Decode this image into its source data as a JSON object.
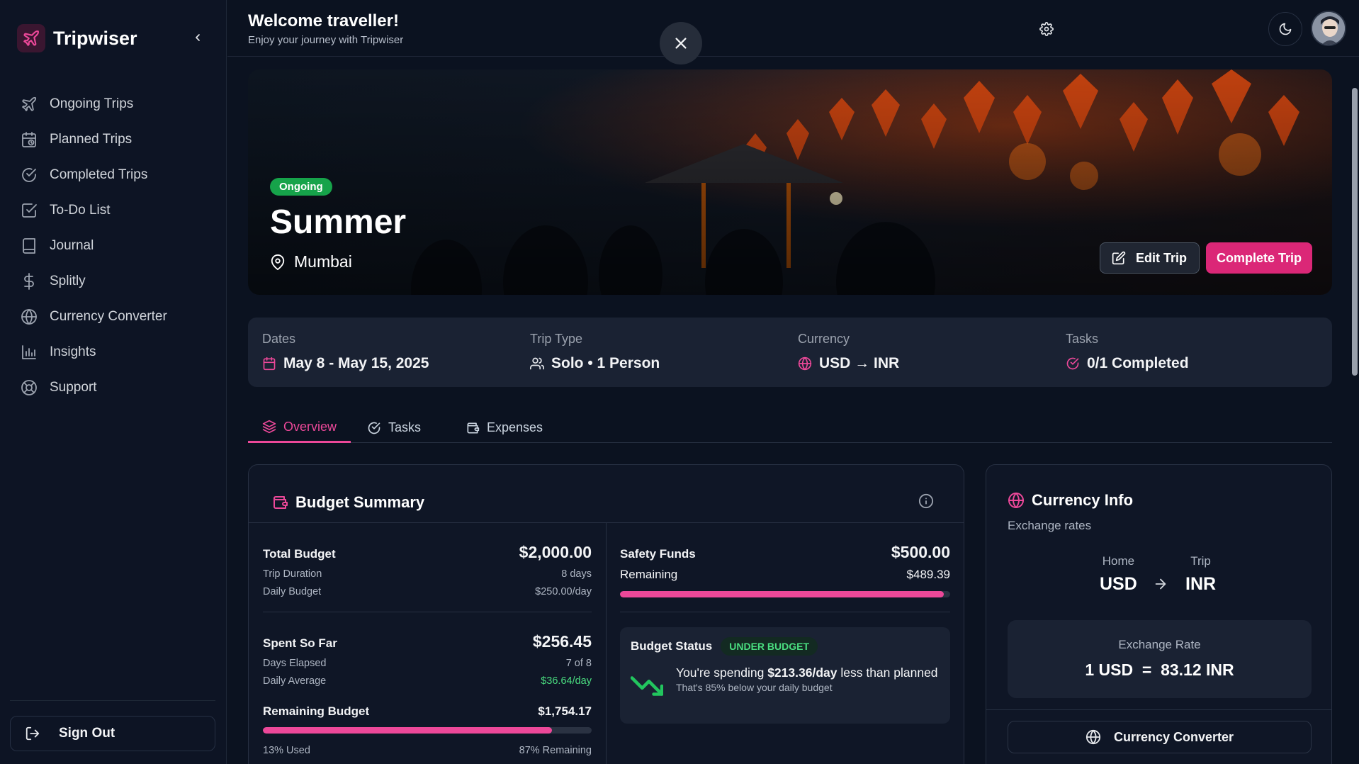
{
  "app": {
    "name": "Tripwiser"
  },
  "sidebar": {
    "items": [
      {
        "label": "Ongoing Trips",
        "icon": "plane-icon"
      },
      {
        "label": "Planned Trips",
        "icon": "calendar-clock-icon"
      },
      {
        "label": "Completed Trips",
        "icon": "check-circle-icon"
      },
      {
        "label": "To-Do List",
        "icon": "checkbox-icon"
      },
      {
        "label": "Journal",
        "icon": "book-icon"
      },
      {
        "label": "Splitly",
        "icon": "dollar-icon"
      },
      {
        "label": "Currency Converter",
        "icon": "globe-icon"
      },
      {
        "label": "Insights",
        "icon": "bar-chart-icon"
      },
      {
        "label": "Support",
        "icon": "lifebuoy-icon"
      }
    ],
    "sign_out": "Sign Out"
  },
  "header": {
    "title": "Welcome traveller!",
    "subtitle": "Enjoy your journey with Tripwiser"
  },
  "trip": {
    "status": "Ongoing",
    "name": "Summer",
    "location": "Mumbai",
    "edit_label": "Edit Trip",
    "complete_label": "Complete Trip"
  },
  "info": {
    "dates_label": "Dates",
    "dates_value": "May 8 - May 15, 2025",
    "type_label": "Trip Type",
    "type_value": "Solo • 1 Person",
    "currency_label": "Currency",
    "currency_value": "USD → INR",
    "tasks_label": "Tasks",
    "tasks_value": "0/1 Completed"
  },
  "tabs": [
    "Overview",
    "Tasks",
    "Expenses"
  ],
  "budget": {
    "title": "Budget Summary",
    "total_label": "Total Budget",
    "total_value": "$2,000.00",
    "duration_label": "Trip Duration",
    "duration_value": "8 days",
    "daily_label": "Daily Budget",
    "daily_value": "$250.00/day",
    "spent_label": "Spent So Far",
    "spent_value": "$256.45",
    "elapsed_label": "Days Elapsed",
    "elapsed_value": "7 of 8",
    "avg_label": "Daily Average",
    "avg_value": "$36.64/day",
    "remaining_label": "Remaining Budget",
    "remaining_value": "$1,754.17",
    "used_label": "13% Used",
    "remaining_pct_label": "87% Remaining",
    "used_fraction": 0.88,
    "safety_label": "Safety Funds",
    "safety_value": "$500.00",
    "safety_remaining_label": "Remaining",
    "safety_remaining_value": "$489.39",
    "safety_fraction": 0.98,
    "status_label": "Budget Status",
    "status_badge": "UNDER BUDGET",
    "status_pre": "You're spending ",
    "status_amount": "$213.36/day",
    "status_post": " less than planned",
    "status_sub": "That's 85% below your daily budget"
  },
  "currency": {
    "title": "Currency Info",
    "subtitle": "Exchange rates",
    "home_label": "Home",
    "home_value": "USD",
    "trip_label": "Trip",
    "trip_value": "INR",
    "rate_label": "Exchange Rate",
    "rate_value": "1 USD  =  83.12 INR",
    "converter_label": "Currency Converter"
  },
  "colors": {
    "accent": "#ec4899",
    "success": "#22c55e",
    "background": "#0b1220",
    "card": "#1a2233"
  }
}
